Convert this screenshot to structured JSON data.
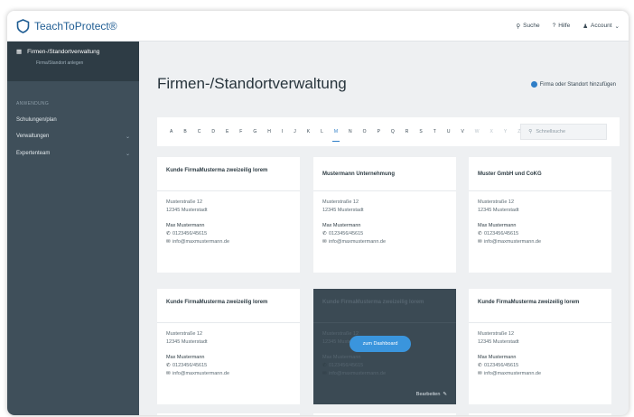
{
  "app": {
    "name": "TeachToProtect®"
  },
  "topbar": {
    "search_label": "Suche",
    "help_label": "Hilfe",
    "account_label": "Account"
  },
  "sidebar": {
    "active_item": {
      "label": "Firmen-/Standortverwaltung",
      "sub": "Firma/Standort anlegen"
    },
    "section_label": "ANWENDUNG",
    "items": [
      {
        "label": "Schulungen/plan"
      },
      {
        "label": "Verwaltungen"
      },
      {
        "label": "Expertenteam"
      }
    ]
  },
  "page": {
    "title": "Firmen-/Standortverwaltung",
    "add_label": "Firma oder Standort hinzufügen"
  },
  "alphabet": {
    "letters": [
      "A",
      "B",
      "C",
      "D",
      "E",
      "F",
      "G",
      "H",
      "I",
      "J",
      "K",
      "L",
      "M",
      "N",
      "O",
      "P",
      "Q",
      "R",
      "S",
      "T",
      "U",
      "V",
      "W",
      "X",
      "Y",
      "Z"
    ],
    "active": "M",
    "search_placeholder": "Schnellsuche"
  },
  "cards": [
    {
      "title": "Kunde FirmaMusterma zweizeilig lorem",
      "street": "Musterstraße 12",
      "city": "12345 Musterstadt",
      "person": "Max Mustermann",
      "phone": "0123456/45615",
      "email": "info@maxmustermann.de"
    },
    {
      "title": "Mustermann Unternehmung",
      "street": "Musterstraße 12",
      "city": "12345 Musterstadt",
      "person": "Max Mustermann",
      "phone": "0123456/45615",
      "email": "info@maxmustermann.de"
    },
    {
      "title": "Muster GmbH und CoKG",
      "street": "Musterstraße 12",
      "city": "12345 Musterstadt",
      "person": "Max Mustermann",
      "phone": "0123456/45615",
      "email": "info@maxmustermann.de"
    },
    {
      "title": "Kunde FirmaMusterma zweizeilig lorem",
      "street": "Musterstraße 12",
      "city": "12345 Musterstadt",
      "person": "Max Mustermann",
      "phone": "0123456/45615",
      "email": "info@maxmustermann.de"
    },
    {
      "title": "Kunde FirmaMusterma zweizeilig lorem",
      "street": "Musterstraße 12",
      "city": "12345 Musterstadt",
      "person": "Max Mustermann",
      "phone": "0123456/45615",
      "email": "info@maxmustermann.de",
      "dashboard_label": "zum Dashboard",
      "edit_label": "Bearbeiten"
    },
    {
      "title": "Kunde FirmaMusterma zweizeilig lorem",
      "street": "Musterstraße 12",
      "city": "12345 Musterstadt",
      "person": "Max Mustermann",
      "phone": "0123456/45615",
      "email": "info@maxmustermann.de"
    }
  ],
  "colors": {
    "sidebar": "#3f4f5a",
    "accent": "#2f7ec7",
    "button": "#3a95dd",
    "hover_card": "#3b4a54"
  }
}
